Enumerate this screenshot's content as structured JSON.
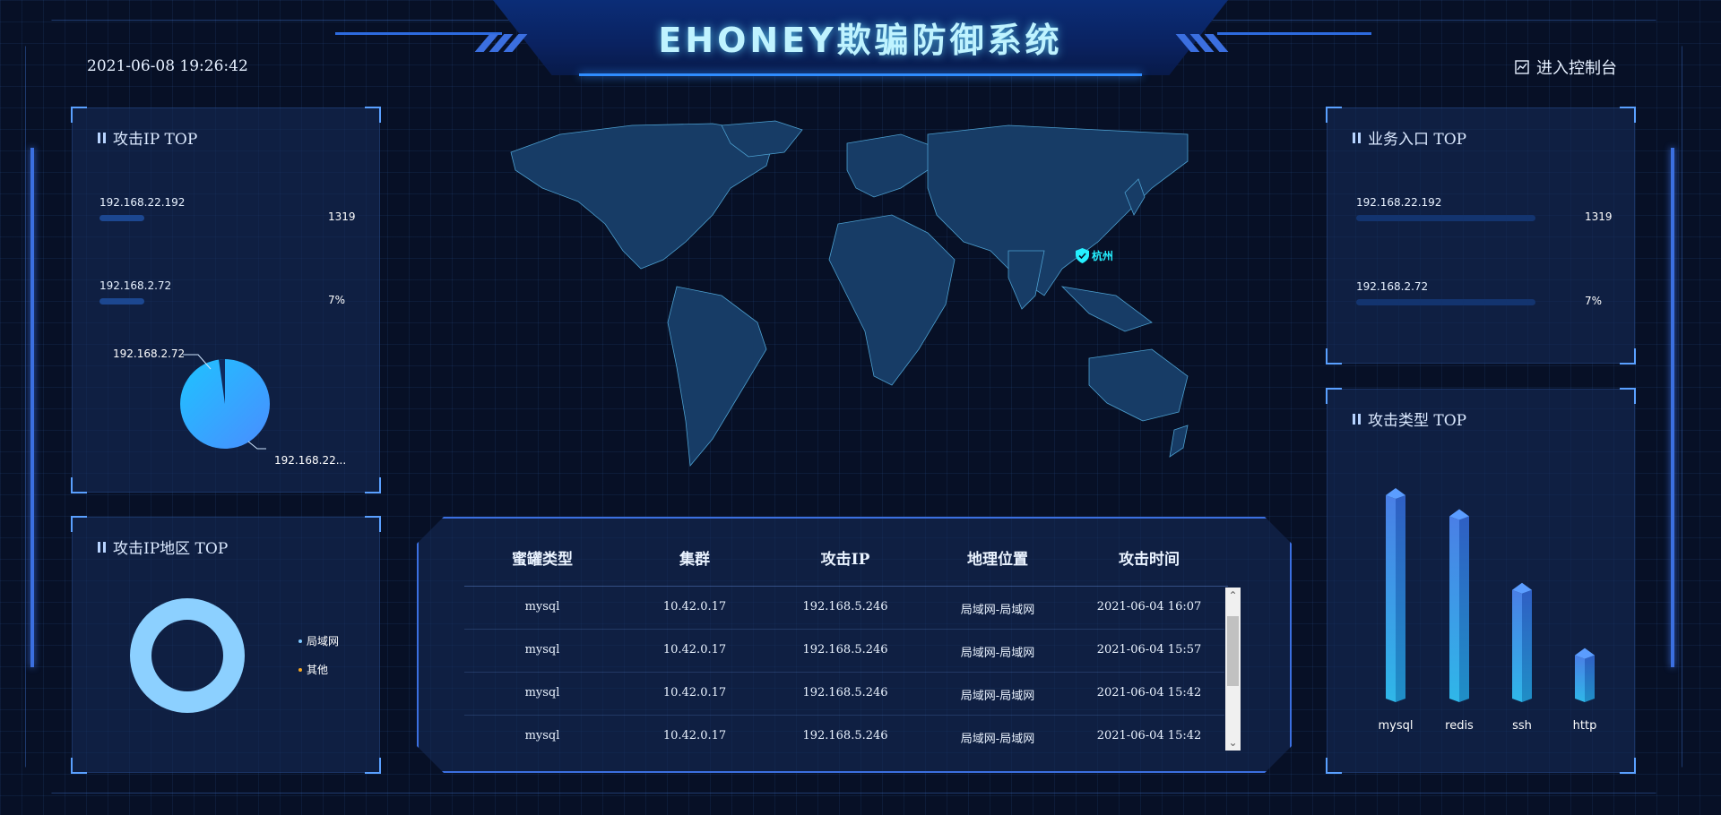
{
  "header": {
    "title": "EHONEY欺骗防御系统",
    "datetime": "2021-06-08 19:26:42",
    "console_label": "进入控制台"
  },
  "attack_ip_top": {
    "title": "攻击IP TOP",
    "items": [
      {
        "ip": "192.168.22.192",
        "value": "1319",
        "fill": 0.18
      },
      {
        "ip": "192.168.2.72",
        "value": "7%",
        "fill": 0.18
      }
    ],
    "pie": {
      "label_small": "192.168.2.72",
      "label_large": "192.168.22...",
      "small_share": 0.005
    }
  },
  "attack_region_top": {
    "title": "攻击IP地区 TOP",
    "legend": [
      {
        "label": "局域网",
        "color": "#7ec8ff"
      },
      {
        "label": "其他",
        "color": "#f5a623"
      }
    ]
  },
  "business_entry_top": {
    "title": "业务入口 TOP",
    "items": [
      {
        "ip": "192.168.22.192",
        "value": "1319",
        "fill": 1.0
      },
      {
        "ip": "192.168.2.72",
        "value": "7%",
        "fill": 1.0
      }
    ]
  },
  "map": {
    "marker_label": "杭州"
  },
  "attack_table": {
    "columns": [
      "蜜罐类型",
      "集群",
      "攻击IP",
      "地理位置",
      "攻击时间"
    ],
    "rows": [
      [
        "mysql",
        "10.42.0.17",
        "192.168.5.246",
        "局域网-局域网",
        "2021-06-04 16:07"
      ],
      [
        "mysql",
        "10.42.0.17",
        "192.168.5.246",
        "局域网-局域网",
        "2021-06-04 15:57"
      ],
      [
        "mysql",
        "10.42.0.17",
        "192.168.5.246",
        "局域网-局域网",
        "2021-06-04 15:42"
      ],
      [
        "mysql",
        "10.42.0.17",
        "192.168.5.246",
        "局域网-局域网",
        "2021-06-04 15:42"
      ]
    ]
  },
  "attack_type_top": {
    "title": "攻击类型 TOP"
  },
  "chart_data": [
    {
      "type": "bar",
      "title": "攻击类型 TOP",
      "categories": [
        "mysql",
        "redis",
        "ssh",
        "http"
      ],
      "values": [
        100,
        90,
        55,
        24
      ],
      "ylim": [
        0,
        100
      ],
      "grid": false
    }
  ],
  "colors": {
    "accent": "#3b6fe0",
    "title_glow": "#bff3ff",
    "marker": "#25f0ff"
  }
}
